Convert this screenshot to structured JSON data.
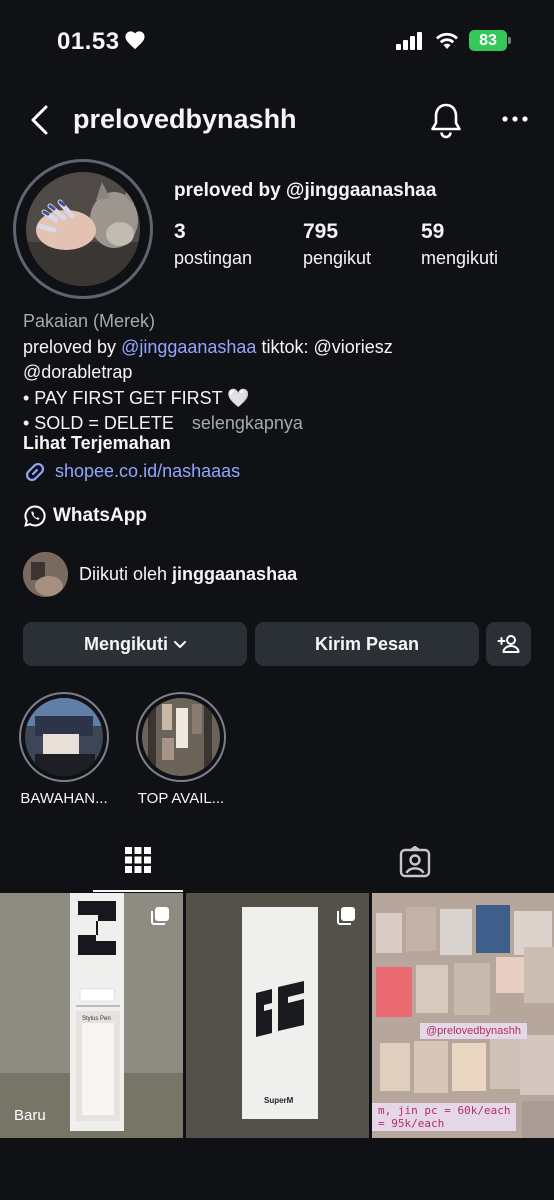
{
  "status_bar": {
    "time": "01.53",
    "battery": "83"
  },
  "header": {
    "username": "prelovedbynashh"
  },
  "profile": {
    "display_name": "preloved by @jinggaanashaa",
    "stats": [
      {
        "value": "3",
        "label": "postingan"
      },
      {
        "value": "795",
        "label": "pengikut"
      },
      {
        "value": "59",
        "label": "mengikuti"
      }
    ],
    "category": "Pakaian (Merek)",
    "bio_prefix": "preloved by ",
    "bio_mention": "@jinggaanashaa",
    "bio_tiktok": " tiktok: @vioriesz",
    "bio_line2": "@dorabletrap",
    "bio_line3": "• PAY FIRST GET FIRST 🤍",
    "bio_line4": "• SOLD = DELETE",
    "more": "selengkapnya",
    "translate": "Lihat Terjemahan",
    "link": "shopee.co.id/nashaaas",
    "whatsapp": "WhatsApp",
    "followed_by_prefix": "Diikuti oleh ",
    "followed_by_name": "jinggaanashaa"
  },
  "actions": {
    "following": "Mengikuti",
    "message": "Kirim Pesan"
  },
  "highlights": [
    {
      "label": "BAWAHAN..."
    },
    {
      "label": "TOP AVAIL..."
    }
  ],
  "posts": [
    {
      "badge": "Baru",
      "box_text": "Stylus Pen"
    },
    {
      "box_text": "SuperM"
    },
    {
      "handle": "@prelovedbynashh",
      "price_line1": "m, jin pc = 60k/each",
      "price_line2": " = 95k/each"
    }
  ]
}
